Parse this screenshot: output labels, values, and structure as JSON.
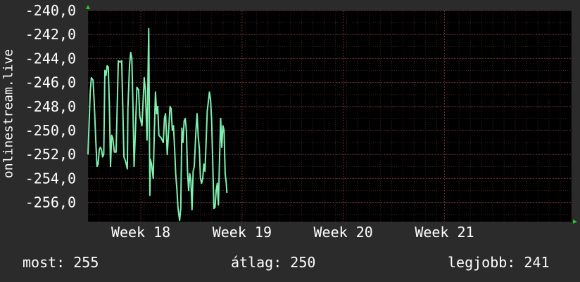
{
  "chart_data": {
    "type": "line",
    "ylabel": "onlinestream.live",
    "ylim": [
      -257.6,
      -240.0
    ],
    "yticks": [
      "-240,0",
      "-242,0",
      "-244,0",
      "-246,0",
      "-248,0",
      "-250,0",
      "-252,0",
      "-254,0",
      "-256,0"
    ],
    "ytick_values": [
      -240,
      -242,
      -244,
      -246,
      -248,
      -250,
      -252,
      -254,
      -256
    ],
    "xlim": [
      0,
      43
    ],
    "xticks": [
      "Week 18",
      "Week 19",
      "Week 20",
      "Week 21"
    ],
    "xtick_positions": [
      4.7,
      13.7,
      22.7,
      31.7
    ],
    "colors": {
      "line": "#7ff0b0",
      "background": "#000000",
      "grid": "#5a2a2a",
      "page": "#2b2b2b",
      "axis_arrow": "#22cc22"
    },
    "series": [
      {
        "values": [
          [
            0.0,
            -252.0
          ],
          [
            0.2,
            -246.8
          ],
          [
            0.3,
            -245.6
          ],
          [
            0.45,
            -245.8
          ],
          [
            0.55,
            -247.6
          ],
          [
            0.7,
            -251.0
          ],
          [
            0.8,
            -253.0
          ],
          [
            0.9,
            -252.8
          ],
          [
            1.0,
            -251.6
          ],
          [
            1.1,
            -251.4
          ],
          [
            1.2,
            -251.6
          ],
          [
            1.3,
            -252.2
          ],
          [
            1.4,
            -252.0
          ],
          [
            1.5,
            -245.0
          ],
          [
            1.6,
            -245.4
          ],
          [
            1.7,
            -244.6
          ],
          [
            1.8,
            -244.7
          ],
          [
            1.9,
            -248.0
          ],
          [
            2.0,
            -253.0
          ],
          [
            2.1,
            -250.4
          ],
          [
            2.2,
            -250.6
          ],
          [
            2.35,
            -251.8
          ],
          [
            2.5,
            -251.8
          ],
          [
            2.7,
            -244.2
          ],
          [
            2.85,
            -244.3
          ],
          [
            3.0,
            -244.2
          ],
          [
            3.2,
            -252.2
          ],
          [
            3.35,
            -252.6
          ],
          [
            3.5,
            -253.2
          ],
          [
            3.55,
            -248.2
          ],
          [
            3.7,
            -244.5
          ],
          [
            3.8,
            -243.5
          ],
          [
            3.9,
            -244.0
          ],
          [
            4.0,
            -248.0
          ],
          [
            4.1,
            -253.0
          ],
          [
            4.2,
            -250.5
          ],
          [
            4.35,
            -246.4
          ],
          [
            4.5,
            -246.6
          ],
          [
            4.6,
            -248.8
          ],
          [
            4.8,
            -249.6
          ],
          [
            5.0,
            -245.6
          ],
          [
            5.1,
            -246.6
          ],
          [
            5.25,
            -250.8
          ],
          [
            5.4,
            -241.5
          ],
          [
            5.5,
            -255.4
          ],
          [
            5.55,
            -252.4
          ],
          [
            5.65,
            -252.8
          ],
          [
            5.8,
            -254.0
          ],
          [
            5.9,
            -250.0
          ],
          [
            6.0,
            -246.8
          ],
          [
            6.1,
            -248.6
          ],
          [
            6.2,
            -248.0
          ],
          [
            6.3,
            -250.4
          ],
          [
            6.5,
            -250.6
          ],
          [
            6.7,
            -251.0
          ],
          [
            6.8,
            -249.0
          ],
          [
            6.9,
            -248.6
          ],
          [
            7.05,
            -252.0
          ],
          [
            7.2,
            -249.6
          ],
          [
            7.3,
            -248.0
          ],
          [
            7.4,
            -248.2
          ],
          [
            7.5,
            -250.0
          ],
          [
            7.6,
            -249.6
          ],
          [
            7.7,
            -251.4
          ],
          [
            7.8,
            -253.6
          ],
          [
            7.9,
            -254.8
          ],
          [
            8.0,
            -256.4
          ],
          [
            8.05,
            -256.8
          ],
          [
            8.15,
            -257.5
          ],
          [
            8.25,
            -256.5
          ],
          [
            8.35,
            -249.8
          ],
          [
            8.45,
            -251.0
          ],
          [
            8.55,
            -249.2
          ],
          [
            8.65,
            -249.0
          ],
          [
            8.75,
            -250.0
          ],
          [
            8.85,
            -253.4
          ],
          [
            8.95,
            -255.0
          ],
          [
            9.05,
            -253.6
          ],
          [
            9.15,
            -254.2
          ],
          [
            9.25,
            -256.6
          ],
          [
            9.35,
            -253.4
          ],
          [
            9.45,
            -253.0
          ],
          [
            9.6,
            -250.0
          ],
          [
            9.7,
            -248.6
          ],
          [
            9.8,
            -250.5
          ],
          [
            9.9,
            -251.5
          ],
          [
            10.0,
            -254.0
          ],
          [
            10.1,
            -254.4
          ],
          [
            10.2,
            -254.0
          ],
          [
            10.3,
            -252.8
          ],
          [
            10.4,
            -253.4
          ],
          [
            10.5,
            -251.0
          ],
          [
            10.6,
            -248.4
          ],
          [
            10.7,
            -247.6
          ],
          [
            10.8,
            -246.8
          ],
          [
            10.9,
            -247.4
          ],
          [
            11.0,
            -249.2
          ],
          [
            11.1,
            -252.8
          ],
          [
            11.2,
            -256.5
          ],
          [
            11.3,
            -256.4
          ],
          [
            11.4,
            -255.0
          ],
          [
            11.5,
            -254.4
          ],
          [
            11.6,
            -256.2
          ],
          [
            11.7,
            -252.4
          ],
          [
            11.8,
            -249.0
          ],
          [
            11.9,
            -251.4
          ],
          [
            12.0,
            -249.6
          ],
          [
            12.1,
            -250.0
          ],
          [
            12.2,
            -253.6
          ],
          [
            12.3,
            -254.4
          ],
          [
            12.35,
            -255.2
          ]
        ]
      }
    ]
  },
  "footer": {
    "now": "most: 255",
    "average": "átlag: 250",
    "best": "legjobb: 241"
  }
}
